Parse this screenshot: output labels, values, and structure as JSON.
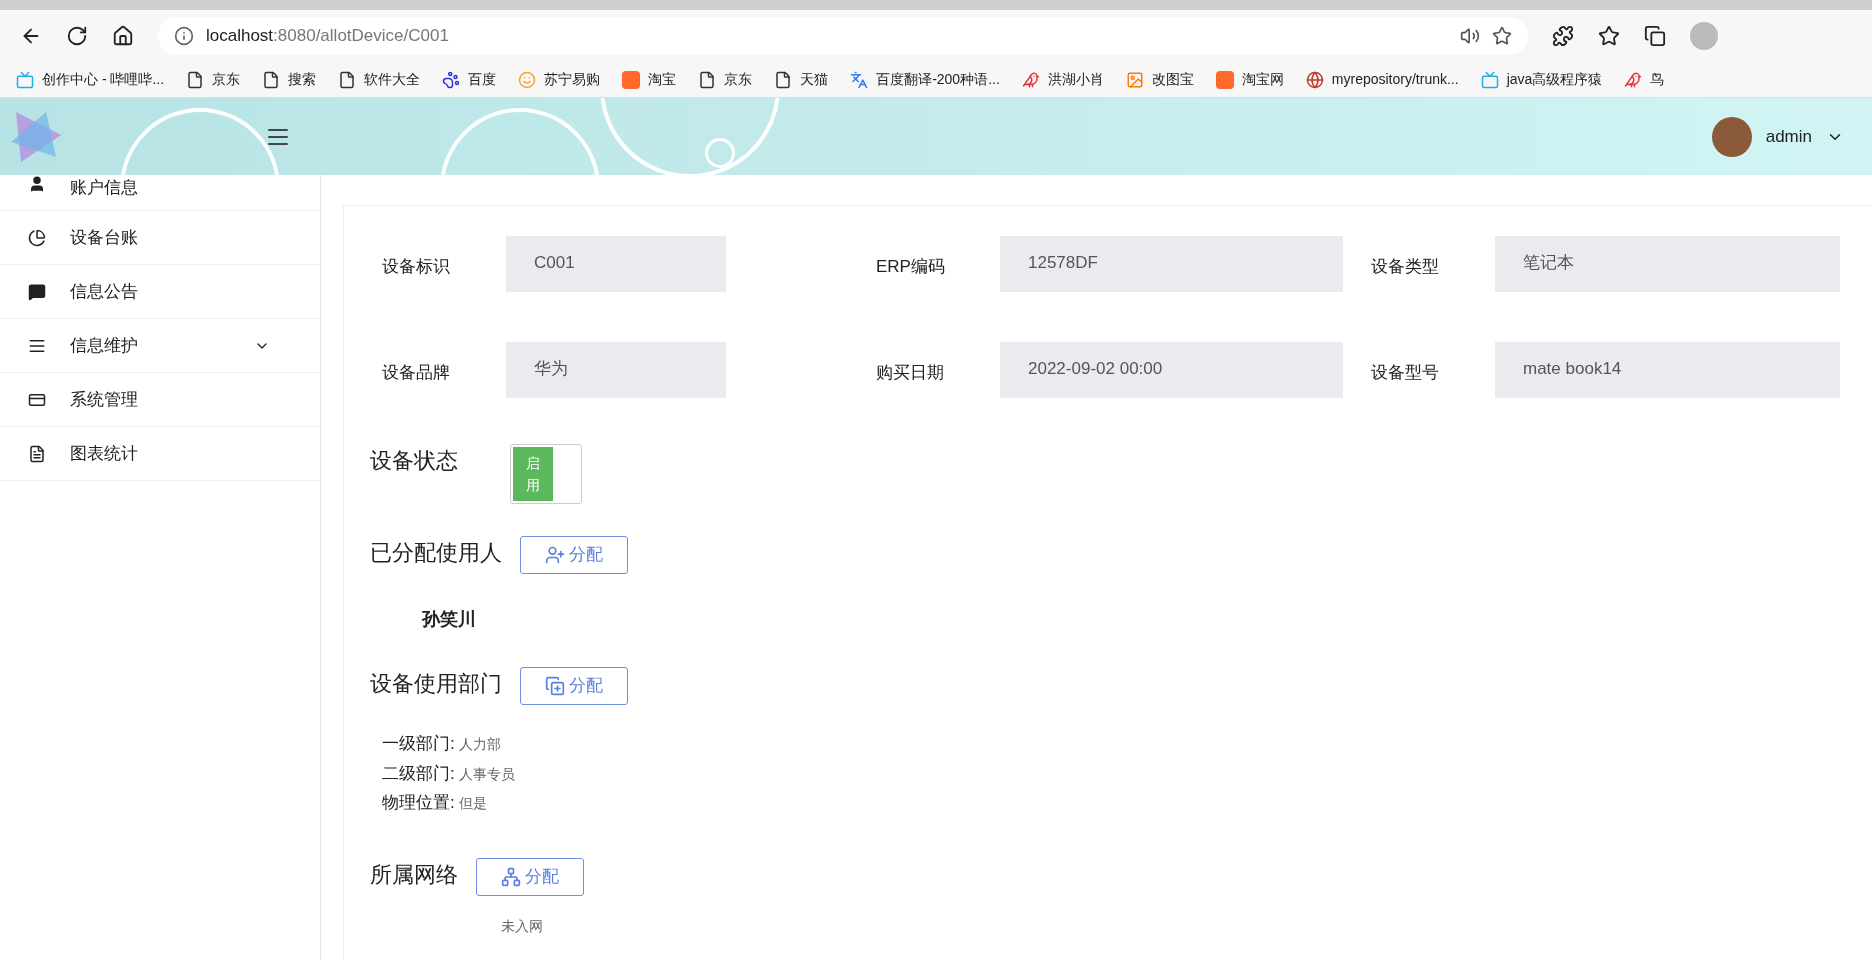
{
  "browser": {
    "url_host": "localhost",
    "url_rest": ":8080/allotDevice/C001",
    "bookmarks": [
      {
        "kind": "tv",
        "label": "创作中心 - 哔哩哔..."
      },
      {
        "kind": "page",
        "label": "京东"
      },
      {
        "kind": "page",
        "label": "搜索"
      },
      {
        "kind": "page",
        "label": "软件大全"
      },
      {
        "kind": "paw",
        "label": "百度"
      },
      {
        "kind": "face",
        "label": "苏宁易购"
      },
      {
        "kind": "tao",
        "label": "淘宝"
      },
      {
        "kind": "page",
        "label": "京东"
      },
      {
        "kind": "page",
        "label": "天猫"
      },
      {
        "kind": "translate",
        "label": "百度翻译-200种语..."
      },
      {
        "kind": "bird",
        "label": "洪湖小肖"
      },
      {
        "kind": "app",
        "label": "改图宝"
      },
      {
        "kind": "tao",
        "label": "淘宝网"
      },
      {
        "kind": "globe",
        "label": "myrepository/trunk..."
      },
      {
        "kind": "tv",
        "label": "java高级程序猿"
      },
      {
        "kind": "bird",
        "label": "鸟"
      }
    ]
  },
  "header": {
    "user": "admin"
  },
  "sidebar": {
    "items": [
      {
        "kind": "user",
        "label": "账户信息",
        "expandable": false
      },
      {
        "kind": "pie",
        "label": "设备台账",
        "expandable": false
      },
      {
        "kind": "chat",
        "label": "信息公告",
        "expandable": false
      },
      {
        "kind": "list",
        "label": "信息维护",
        "expandable": true
      },
      {
        "kind": "system",
        "label": "系统管理",
        "expandable": false
      },
      {
        "kind": "doc",
        "label": "图表统计",
        "expandable": false
      }
    ]
  },
  "form": {
    "rows": [
      [
        {
          "label": "设备标识",
          "value": "C001"
        },
        {
          "label": "ERP编码",
          "value": "12578DF"
        },
        {
          "label": "设备类型",
          "value": "笔记本"
        }
      ],
      [
        {
          "label": "设备品牌",
          "value": "华为"
        },
        {
          "label": "购买日期",
          "value": "2022-09-02 00:00"
        },
        {
          "label": "设备型号",
          "value": "mate book14"
        }
      ]
    ]
  },
  "status": {
    "label": "设备状态",
    "on": true,
    "text": "启用"
  },
  "user_section": {
    "title": "已分配使用人",
    "button": "分配",
    "assignee": "孙笑川"
  },
  "dept_section": {
    "title": "设备使用部门",
    "button": "分配",
    "details": [
      {
        "label": "一级部门:",
        "value": "人力部"
      },
      {
        "label": "二级部门:",
        "value": "人事专员"
      },
      {
        "label": "物理位置:",
        "value": "但是"
      }
    ]
  },
  "network_section": {
    "title": "所属网络",
    "button": "分配",
    "value": "未入网"
  }
}
